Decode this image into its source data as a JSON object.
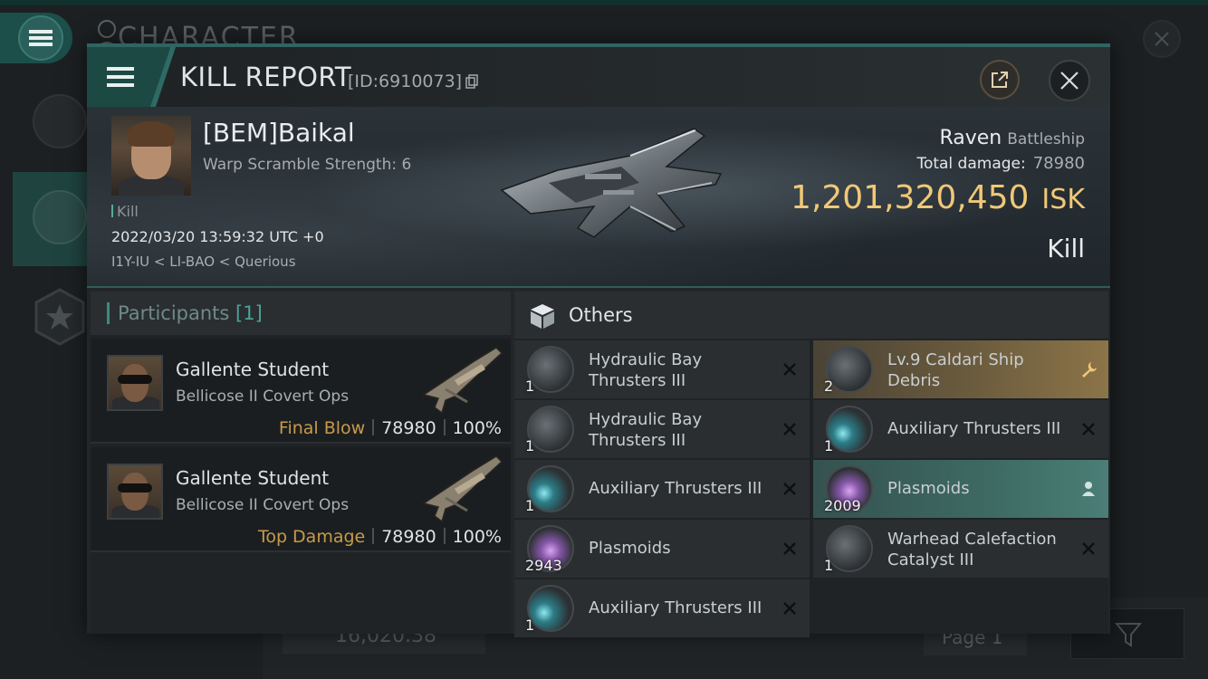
{
  "background": {
    "title": "CHARACTER",
    "bottom_value": "16,020.38",
    "page_label": "Page 1"
  },
  "header": {
    "title": "KILL REPORT",
    "id_text": "[ID:6910073]"
  },
  "victim": {
    "name": "[BEM]Baikal",
    "warp_scramble": "Warp Scramble Strength: 6",
    "kill_tag": "Kill",
    "datetime": "2022/03/20 13:59:32 UTC +0",
    "location": "I1Y-IU < LI-BAO < Querious",
    "ship_name": "Raven",
    "ship_class": "Battleship",
    "total_damage_label": "Total damage:",
    "total_damage": "78980",
    "isk_value": "1,201,320,450",
    "isk_unit": "ISK",
    "result": "Kill"
  },
  "participants": {
    "label": "Participants",
    "count": "[1]",
    "rows": [
      {
        "name": "Gallente Student",
        "ship": "Bellicose II Covert Ops",
        "tag": "Final Blow",
        "damage": "78980",
        "percent": "100%"
      },
      {
        "name": "Gallente Student",
        "ship": "Bellicose II Covert Ops",
        "tag": "Top Damage",
        "damage": "78980",
        "percent": "100%"
      }
    ]
  },
  "others": {
    "label": "Others",
    "items": [
      {
        "name": "Hydraulic Bay Thrusters III",
        "qty": "1",
        "icon": "thruster-icon",
        "flag": "close-icon"
      },
      {
        "name": "Lv.9 Caldari Ship Debris",
        "qty": "2",
        "icon": "debris-icon",
        "flag": "wrench-icon"
      },
      {
        "name": "Hydraulic Bay Thrusters III",
        "qty": "1",
        "icon": "thruster-icon",
        "flag": "close-icon"
      },
      {
        "name": "Auxiliary Thrusters III",
        "qty": "1",
        "icon": "aux-thruster-icon",
        "flag": "close-icon"
      },
      {
        "name": "Auxiliary Thrusters III",
        "qty": "1",
        "icon": "aux-thruster-icon",
        "flag": "close-icon"
      },
      {
        "name": "Plasmoids",
        "qty": "2009",
        "icon": "plasmoid-icon",
        "flag": "person-icon"
      },
      {
        "name": "Plasmoids",
        "qty": "2943",
        "icon": "plasmoid-icon",
        "flag": "close-icon"
      },
      {
        "name": "Warhead Calefaction Catalyst III",
        "qty": "1",
        "icon": "catalyst-icon",
        "flag": "close-icon"
      },
      {
        "name": "Auxiliary Thrusters III",
        "qty": "1",
        "icon": "aux-thruster-icon",
        "flag": "close-icon"
      }
    ]
  },
  "colors": {
    "accent_teal": "#2f6560",
    "isk_gold": "#f0c878",
    "tag_gold": "#c89a4a",
    "gold_item": "#8c7448",
    "teal_item": "#4a7e76"
  }
}
